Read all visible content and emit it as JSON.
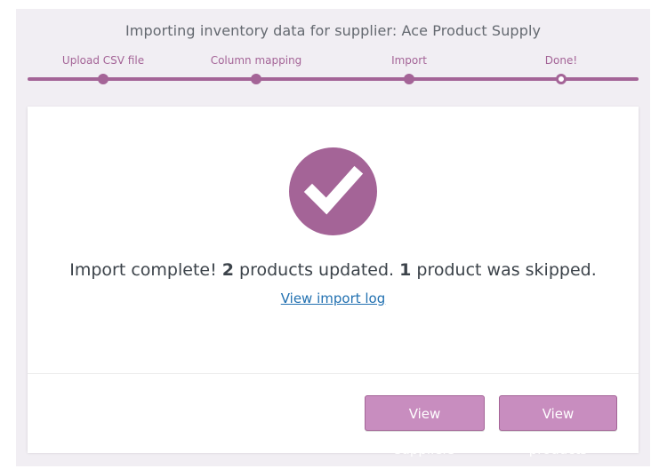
{
  "header": {
    "title": "Importing inventory data for supplier: Ace Product Supply"
  },
  "stepper": {
    "steps": [
      {
        "label": "Upload CSV file",
        "state": "done"
      },
      {
        "label": "Column mapping",
        "state": "done"
      },
      {
        "label": "Import",
        "state": "done"
      },
      {
        "label": "Done!",
        "state": "current"
      }
    ]
  },
  "result": {
    "icon": "checkmark-circle-icon",
    "message_prefix": "Import complete! ",
    "updated_count": "2",
    "message_middle": " products updated. ",
    "skipped_count": "1",
    "message_suffix": " product was skipped.",
    "log_link": "View import log"
  },
  "actions": {
    "view_suppliers": "View suppliers",
    "view_products": "View products"
  },
  "colors": {
    "accent": "#a46497",
    "button_bg": "#c88dbf",
    "link": "#2271b1",
    "text": "#3c434a",
    "background": "#f1eef3"
  }
}
